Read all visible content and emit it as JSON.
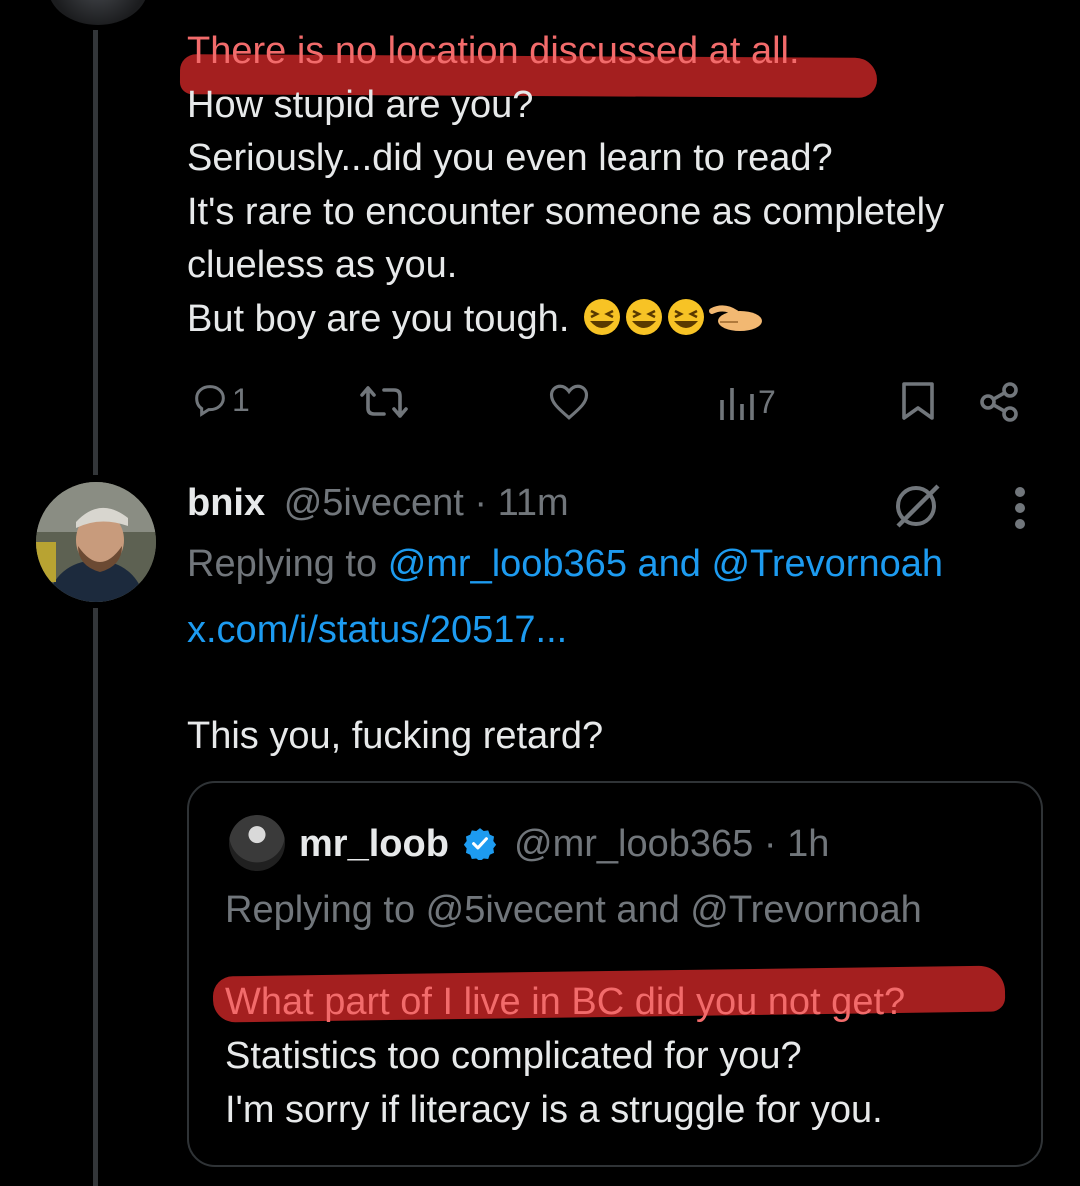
{
  "reply_tweet": {
    "lines": [
      "There is no location discussed at all.",
      "How stupid are you?",
      "Seriously...did you even learn to read?",
      "It's rare to encounter someone as completely",
      "clueless as you.",
      "But boy are you tough."
    ],
    "emojis": "😆😆😆🤏",
    "actions": {
      "reply_count": "1",
      "retweet_count": "",
      "like_count": "",
      "views_count": "7"
    }
  },
  "bnix_tweet": {
    "display_name": "bnix",
    "handle": "@5ivecent",
    "separator": "·",
    "time": "11m",
    "replying_prefix": "Replying to",
    "replying_user1": "@mr_loob365",
    "replying_and": "and",
    "replying_user2": "@Trevornoah",
    "link_text": "x.com/i/status/20517...",
    "body": "This you, fucking retard?"
  },
  "quoted_tweet": {
    "display_name": "mr_loob",
    "handle": "@mr_loob365",
    "separator": "·",
    "time": "1h",
    "replying_text": "Replying to @5ivecent and @Trevornoah",
    "lines": [
      "What part of I live in BC did you not get?",
      "Statistics too complicated for you?",
      "I'm sorry if literacy is a struggle for you."
    ]
  },
  "colors": {
    "background": "#000000",
    "text": "#e7e9ea",
    "muted": "#71767b",
    "link": "#1d9bf0",
    "verified": "#1d9bf0",
    "highlight_marker": "#b22222"
  },
  "icons": [
    "reply-icon",
    "retweet-icon",
    "like-icon",
    "views-icon",
    "bookmark-icon",
    "share-icon",
    "grok-icon",
    "more-icon",
    "verified-badge-icon"
  ]
}
